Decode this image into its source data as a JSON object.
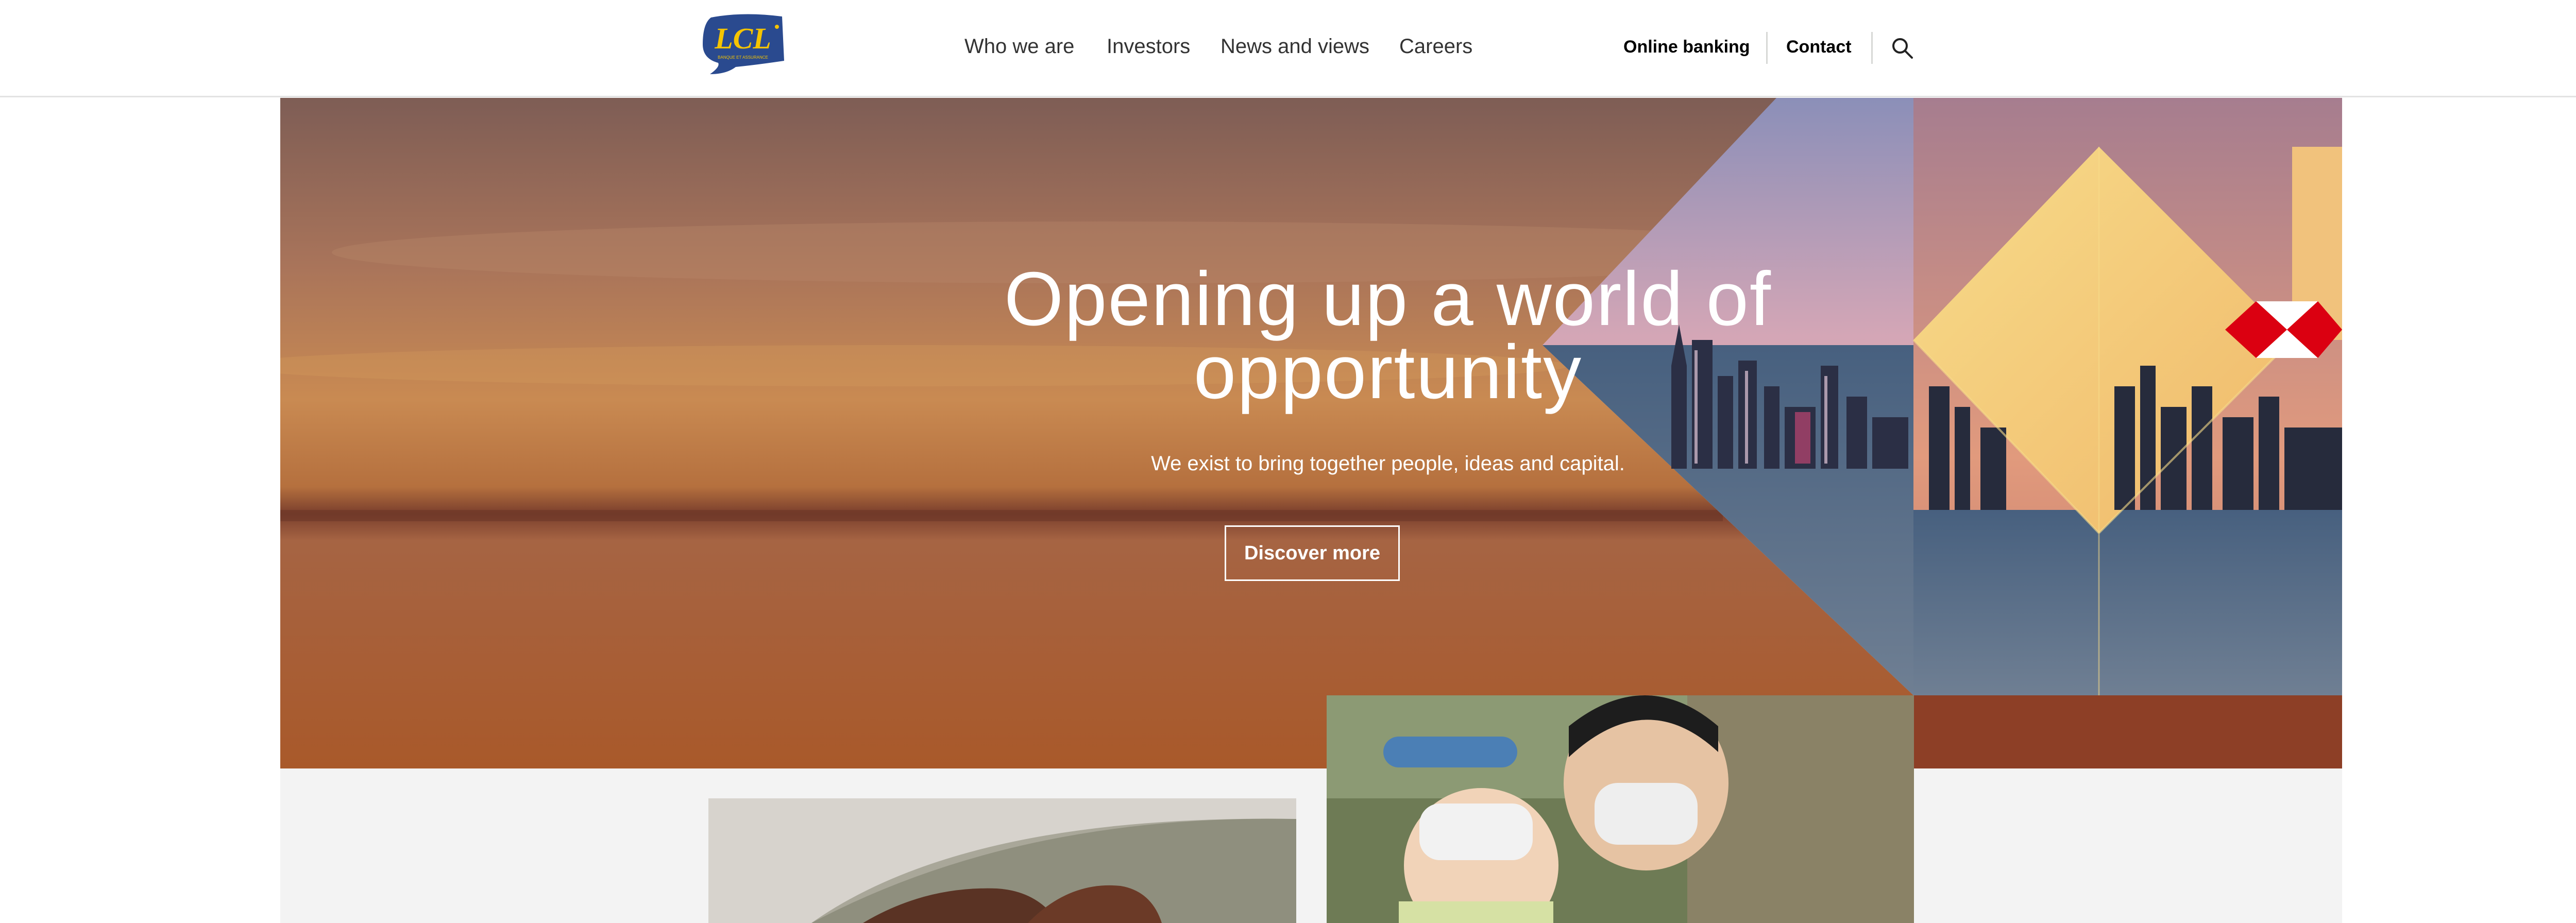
{
  "brand": {
    "logo_text": "LCL",
    "logo_tagline": "BANQUE ET ASSURANCE"
  },
  "nav": {
    "items": [
      {
        "label": "Who we are"
      },
      {
        "label": "Investors"
      },
      {
        "label": "News and views"
      },
      {
        "label": "Careers"
      }
    ]
  },
  "utility": {
    "online_banking": "Online banking",
    "contact": "Contact",
    "search_icon": "search-icon"
  },
  "hero": {
    "headline_line1": "Opening up a world of",
    "headline_line2": "opportunity",
    "subtext": "We exist to bring together people, ideas and capital.",
    "cta_label": "Discover more"
  },
  "colors": {
    "logo_blue": "#2a4a8f",
    "logo_yellow": "#f5c400",
    "hsbc_red": "#db0011",
    "sunset_orange": "#b0602e"
  }
}
